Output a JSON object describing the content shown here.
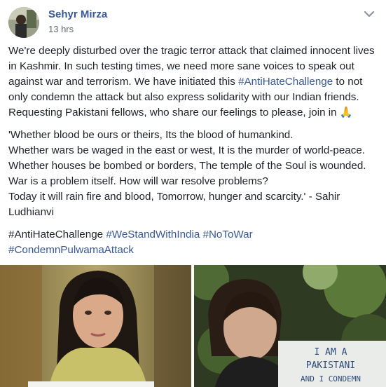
{
  "author": {
    "name": "Sehyr Mirza",
    "time": "13 hrs"
  },
  "post": {
    "paragraph1": "We're deeply disturbed over the tragic terror attack that claimed innocent lives in Kashmir. In such testing times, we need more sane voices to speak out against war and terrorism. We have initiated this ",
    "inline_tag": "#AntiHateChallenge",
    "paragraph1_cont": " to not only condemn the attack but also express solidarity with our Indian friends. Requesting Pakistani fellows, who share our feelings to please, join in ",
    "emoji": "🙏",
    "quote_lines": [
      "'Whether blood be ours or theirs, Its the blood of humankind.",
      "Whether wars be waged in the east or west, It is the murder of world-peace.",
      "Whether houses be bombed or borders, The temple of the Soul is wounded.",
      "War is a problem itself. How will war resolve problems?",
      "Today it will rain fire and blood, Tomorrow, hunger and scarcity.' - Sahir Ludhianvi"
    ],
    "tags": {
      "first": "#AntiHateChallenge",
      "second": "#WeStandWithIndia",
      "third": "#NoToWar",
      "fourth": "#CondemnPulwamaAttack"
    }
  },
  "photos": {
    "sign_line1": "I AM A",
    "sign_line2": "PAKISTANI",
    "sign_line3": "AND I CONDEMN"
  },
  "colors": {
    "link": "#385898",
    "text": "#1d2129",
    "meta": "#616770"
  }
}
